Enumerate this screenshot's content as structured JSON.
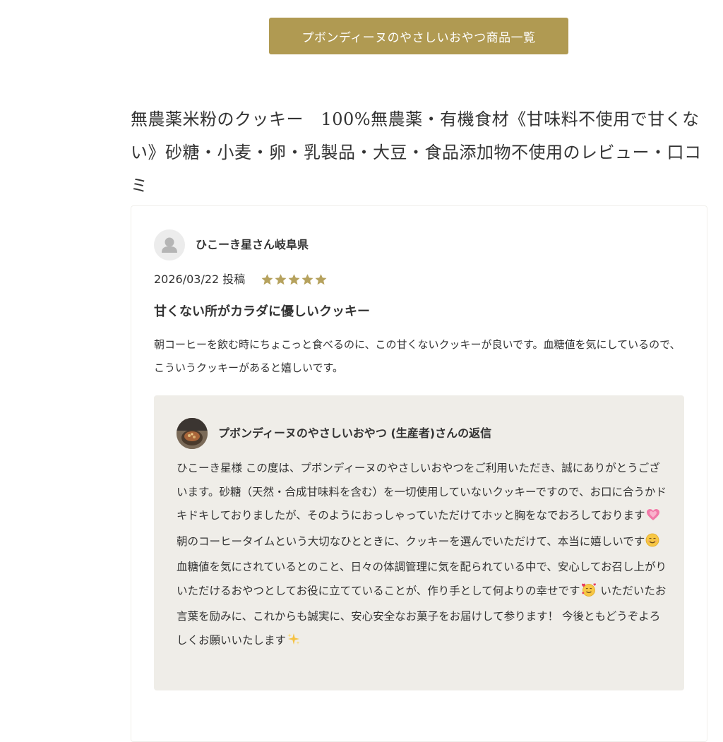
{
  "header": {
    "product_list_button": "プボンディーヌのやさしいおやつ商品一覧"
  },
  "page": {
    "title": "無農薬米粉のクッキー　100%無農薬・有機食材《甘味料不使用で甘くない》砂糖・小麦・卵・乳製品・大豆・食品添加物不使用のレビュー・口コミ"
  },
  "review": {
    "reviewer_name": "ひこーき星さん岐阜県",
    "date": "2026/03/22 投稿",
    "rating": 5,
    "rating_max": 5,
    "star_color": "#b6a25e",
    "title": "甘くない所がカラダに優しいクッキー",
    "body": "朝コーヒーを飲む時にちょこっと食べるのに、この甘くないクッキーが良いです。血糖値を気にしているので、こういうクッキーがあると嬉しいです。"
  },
  "reply": {
    "responder_name": "プボンディーヌのやさしいおやつ (生産者)さんの返信",
    "body_parts": [
      "ひこーき星様 この度は、プボンディーヌのやさしいおやつをご利用いただき、誠にありがとうございます。砂糖（天然・合成甘味料を含む）を一切使用していないクッキーですので、お口に合うかドキドキしておりましたが、そのようにおっしゃっていただけてホッと胸をなでおろしております",
      " 朝のコーヒータイムという大切なひとときに、クッキーを選んでいただけて、本当に嬉しいです",
      " 血糖値を気にされているとのこと、日々の体調管理に気を配られている中で、安心してお召し上がりいただけるおやつとしてお役に立てていることが、作り手として何よりの幸せです",
      " いただいたお言葉を励みに、これからも誠実に、安心安全なお菓子をお届けして参ります！ 今後ともどうぞよろしくお願いいたします"
    ],
    "emojis": [
      "growing-heart-emoji",
      "smiling-face-emoji",
      "smiling-face-with-hearts-emoji",
      "sparkles-emoji"
    ],
    "box_color": "#efede8"
  },
  "colors": {
    "accent": "#b09a52",
    "text": "#333333"
  }
}
